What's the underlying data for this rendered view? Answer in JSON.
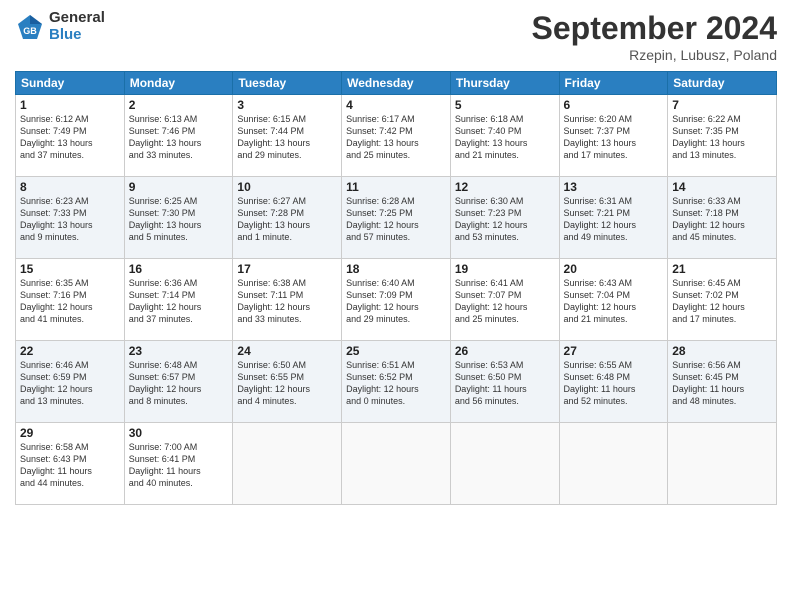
{
  "header": {
    "logo_general": "General",
    "logo_blue": "Blue",
    "title": "September 2024",
    "subtitle": "Rzepin, Lubusz, Poland"
  },
  "days_of_week": [
    "Sunday",
    "Monday",
    "Tuesday",
    "Wednesday",
    "Thursday",
    "Friday",
    "Saturday"
  ],
  "weeks": [
    [
      {
        "day": "1",
        "lines": [
          "Sunrise: 6:12 AM",
          "Sunset: 7:49 PM",
          "Daylight: 13 hours",
          "and 37 minutes."
        ]
      },
      {
        "day": "2",
        "lines": [
          "Sunrise: 6:13 AM",
          "Sunset: 7:46 PM",
          "Daylight: 13 hours",
          "and 33 minutes."
        ]
      },
      {
        "day": "3",
        "lines": [
          "Sunrise: 6:15 AM",
          "Sunset: 7:44 PM",
          "Daylight: 13 hours",
          "and 29 minutes."
        ]
      },
      {
        "day": "4",
        "lines": [
          "Sunrise: 6:17 AM",
          "Sunset: 7:42 PM",
          "Daylight: 13 hours",
          "and 25 minutes."
        ]
      },
      {
        "day": "5",
        "lines": [
          "Sunrise: 6:18 AM",
          "Sunset: 7:40 PM",
          "Daylight: 13 hours",
          "and 21 minutes."
        ]
      },
      {
        "day": "6",
        "lines": [
          "Sunrise: 6:20 AM",
          "Sunset: 7:37 PM",
          "Daylight: 13 hours",
          "and 17 minutes."
        ]
      },
      {
        "day": "7",
        "lines": [
          "Sunrise: 6:22 AM",
          "Sunset: 7:35 PM",
          "Daylight: 13 hours",
          "and 13 minutes."
        ]
      }
    ],
    [
      {
        "day": "8",
        "lines": [
          "Sunrise: 6:23 AM",
          "Sunset: 7:33 PM",
          "Daylight: 13 hours",
          "and 9 minutes."
        ]
      },
      {
        "day": "9",
        "lines": [
          "Sunrise: 6:25 AM",
          "Sunset: 7:30 PM",
          "Daylight: 13 hours",
          "and 5 minutes."
        ]
      },
      {
        "day": "10",
        "lines": [
          "Sunrise: 6:27 AM",
          "Sunset: 7:28 PM",
          "Daylight: 13 hours",
          "and 1 minute."
        ]
      },
      {
        "day": "11",
        "lines": [
          "Sunrise: 6:28 AM",
          "Sunset: 7:25 PM",
          "Daylight: 12 hours",
          "and 57 minutes."
        ]
      },
      {
        "day": "12",
        "lines": [
          "Sunrise: 6:30 AM",
          "Sunset: 7:23 PM",
          "Daylight: 12 hours",
          "and 53 minutes."
        ]
      },
      {
        "day": "13",
        "lines": [
          "Sunrise: 6:31 AM",
          "Sunset: 7:21 PM",
          "Daylight: 12 hours",
          "and 49 minutes."
        ]
      },
      {
        "day": "14",
        "lines": [
          "Sunrise: 6:33 AM",
          "Sunset: 7:18 PM",
          "Daylight: 12 hours",
          "and 45 minutes."
        ]
      }
    ],
    [
      {
        "day": "15",
        "lines": [
          "Sunrise: 6:35 AM",
          "Sunset: 7:16 PM",
          "Daylight: 12 hours",
          "and 41 minutes."
        ]
      },
      {
        "day": "16",
        "lines": [
          "Sunrise: 6:36 AM",
          "Sunset: 7:14 PM",
          "Daylight: 12 hours",
          "and 37 minutes."
        ]
      },
      {
        "day": "17",
        "lines": [
          "Sunrise: 6:38 AM",
          "Sunset: 7:11 PM",
          "Daylight: 12 hours",
          "and 33 minutes."
        ]
      },
      {
        "day": "18",
        "lines": [
          "Sunrise: 6:40 AM",
          "Sunset: 7:09 PM",
          "Daylight: 12 hours",
          "and 29 minutes."
        ]
      },
      {
        "day": "19",
        "lines": [
          "Sunrise: 6:41 AM",
          "Sunset: 7:07 PM",
          "Daylight: 12 hours",
          "and 25 minutes."
        ]
      },
      {
        "day": "20",
        "lines": [
          "Sunrise: 6:43 AM",
          "Sunset: 7:04 PM",
          "Daylight: 12 hours",
          "and 21 minutes."
        ]
      },
      {
        "day": "21",
        "lines": [
          "Sunrise: 6:45 AM",
          "Sunset: 7:02 PM",
          "Daylight: 12 hours",
          "and 17 minutes."
        ]
      }
    ],
    [
      {
        "day": "22",
        "lines": [
          "Sunrise: 6:46 AM",
          "Sunset: 6:59 PM",
          "Daylight: 12 hours",
          "and 13 minutes."
        ]
      },
      {
        "day": "23",
        "lines": [
          "Sunrise: 6:48 AM",
          "Sunset: 6:57 PM",
          "Daylight: 12 hours",
          "and 8 minutes."
        ]
      },
      {
        "day": "24",
        "lines": [
          "Sunrise: 6:50 AM",
          "Sunset: 6:55 PM",
          "Daylight: 12 hours",
          "and 4 minutes."
        ]
      },
      {
        "day": "25",
        "lines": [
          "Sunrise: 6:51 AM",
          "Sunset: 6:52 PM",
          "Daylight: 12 hours",
          "and 0 minutes."
        ]
      },
      {
        "day": "26",
        "lines": [
          "Sunrise: 6:53 AM",
          "Sunset: 6:50 PM",
          "Daylight: 11 hours",
          "and 56 minutes."
        ]
      },
      {
        "day": "27",
        "lines": [
          "Sunrise: 6:55 AM",
          "Sunset: 6:48 PM",
          "Daylight: 11 hours",
          "and 52 minutes."
        ]
      },
      {
        "day": "28",
        "lines": [
          "Sunrise: 6:56 AM",
          "Sunset: 6:45 PM",
          "Daylight: 11 hours",
          "and 48 minutes."
        ]
      }
    ],
    [
      {
        "day": "29",
        "lines": [
          "Sunrise: 6:58 AM",
          "Sunset: 6:43 PM",
          "Daylight: 11 hours",
          "and 44 minutes."
        ]
      },
      {
        "day": "30",
        "lines": [
          "Sunrise: 7:00 AM",
          "Sunset: 6:41 PM",
          "Daylight: 11 hours",
          "and 40 minutes."
        ]
      },
      {
        "day": "",
        "lines": []
      },
      {
        "day": "",
        "lines": []
      },
      {
        "day": "",
        "lines": []
      },
      {
        "day": "",
        "lines": []
      },
      {
        "day": "",
        "lines": []
      }
    ]
  ]
}
